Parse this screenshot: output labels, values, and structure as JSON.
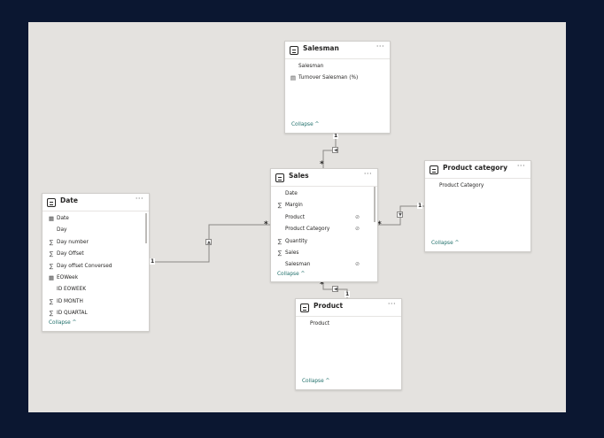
{
  "tables": {
    "salesman": {
      "title": "Salesman",
      "more": "···",
      "fields": [
        {
          "icon": "",
          "icon_name": "none",
          "label": "Salesman"
        },
        {
          "icon": "▤",
          "icon_name": "measure-table-icon",
          "label": "Turnover Salesman (%)"
        }
      ],
      "collapse": "Collapse ^"
    },
    "sales": {
      "title": "Sales",
      "more": "···",
      "fields": [
        {
          "icon": "",
          "icon_name": "none",
          "label": "Date",
          "hidden": false
        },
        {
          "icon": "∑",
          "icon_name": "sigma-icon",
          "label": "Margin",
          "hidden": false
        },
        {
          "icon": "",
          "icon_name": "none",
          "label": "Product",
          "hidden": true
        },
        {
          "icon": "",
          "icon_name": "none",
          "label": "Product Category",
          "hidden": true
        },
        {
          "icon": "∑",
          "icon_name": "sigma-icon",
          "label": "Quantity",
          "hidden": false
        },
        {
          "icon": "∑",
          "icon_name": "sigma-icon",
          "label": "Sales",
          "hidden": false
        },
        {
          "icon": "",
          "icon_name": "none",
          "label": "Salesman",
          "hidden": true
        }
      ],
      "collapse": "Collapse ^"
    },
    "product_category": {
      "title": "Product category",
      "more": "···",
      "fields": [
        {
          "icon": "",
          "icon_name": "none",
          "label": "Product Category"
        }
      ],
      "collapse": "Collapse ^"
    },
    "date": {
      "title": "Date",
      "more": "···",
      "fields": [
        {
          "icon": "▦",
          "icon_name": "calendar-icon",
          "label": "Date"
        },
        {
          "icon": "",
          "icon_name": "none",
          "label": "Day"
        },
        {
          "icon": "∑",
          "icon_name": "sigma-icon",
          "label": "Day number"
        },
        {
          "icon": "∑",
          "icon_name": "sigma-icon",
          "label": "Day Offset"
        },
        {
          "icon": "∑",
          "icon_name": "sigma-icon",
          "label": "Day offset Conversed"
        },
        {
          "icon": "▦",
          "icon_name": "calendar-icon",
          "label": "EOWeek"
        },
        {
          "icon": "",
          "icon_name": "none",
          "label": "ID EOWEEK"
        },
        {
          "icon": "∑",
          "icon_name": "sigma-icon",
          "label": "ID MONTH"
        },
        {
          "icon": "∑",
          "icon_name": "sigma-icon",
          "label": "ID QUARTAL"
        }
      ],
      "collapse": "Collapse ^"
    },
    "product": {
      "title": "Product",
      "more": "···",
      "fields": [
        {
          "icon": "",
          "icon_name": "none",
          "label": "Product"
        }
      ],
      "collapse": "Collapse ^"
    }
  },
  "relationships": {
    "salesman_sales": {
      "one": "1",
      "many": "*"
    },
    "date_sales": {
      "one": "1",
      "many": "*"
    },
    "category_sales": {
      "one": "1",
      "many": "*"
    },
    "product_sales": {
      "one": "1",
      "many": "*"
    }
  },
  "icons": {
    "hidden_field_icon": "eye-slash-icon",
    "table_icon": "table-icon"
  },
  "colors": {
    "background": "#0b1731",
    "canvas": "#e4e2df",
    "collapse_link": "#1f6f6a"
  }
}
